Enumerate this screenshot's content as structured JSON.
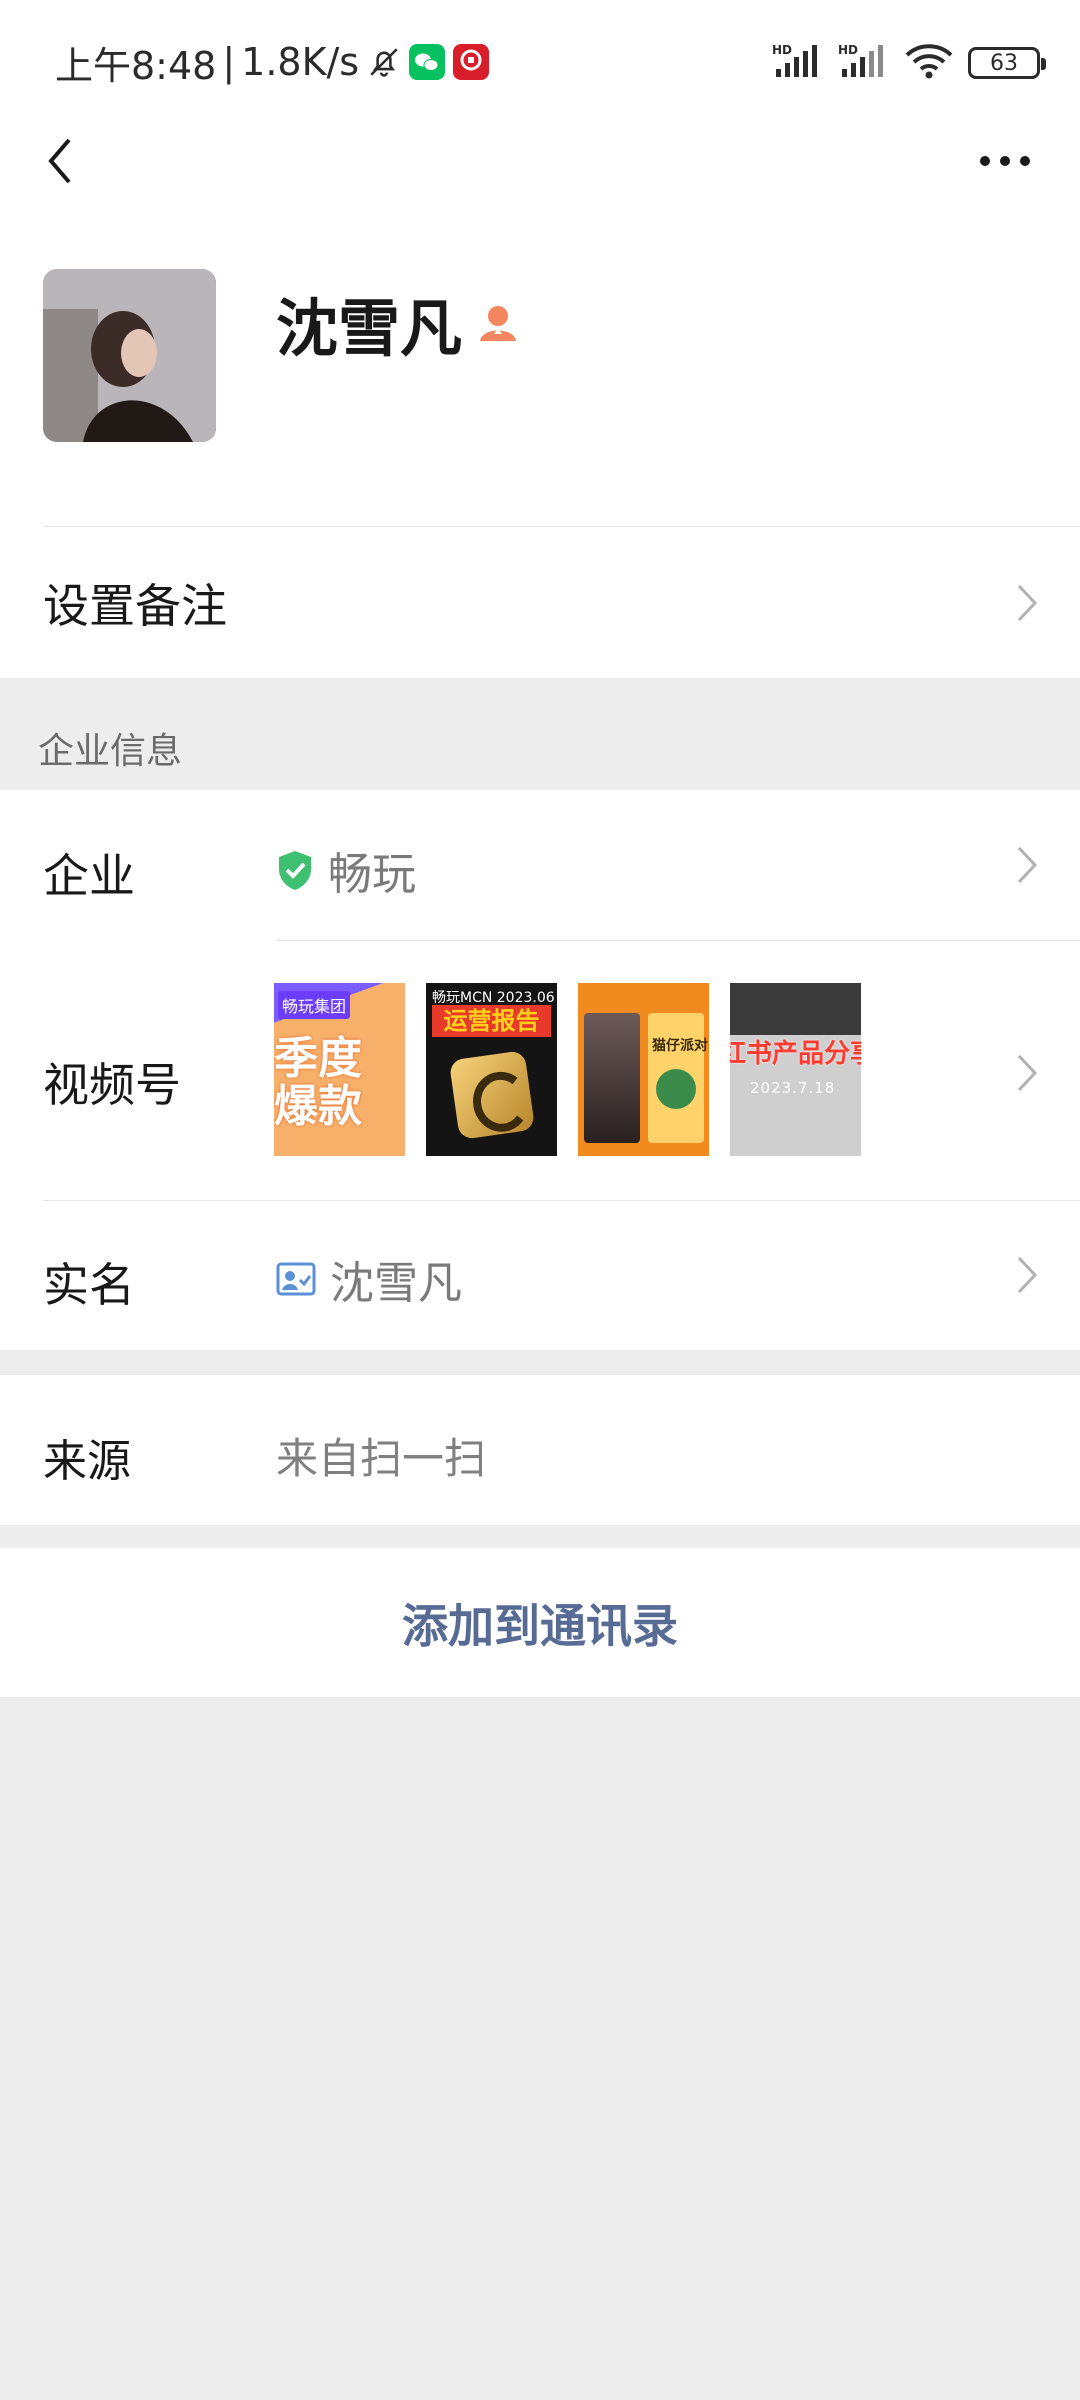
{
  "status_bar": {
    "time": "上午8:48",
    "separator": "|",
    "speed": "1.8K/s",
    "signal_1": "HD",
    "signal_2": "HD",
    "battery": "63"
  },
  "profile": {
    "name": "沈雪凡",
    "remark_label": "设置备注"
  },
  "section": {
    "title": "企业信息"
  },
  "company": {
    "enterprise_label": "企业",
    "enterprise_value": "畅玩",
    "channels_label": "视频号",
    "realname_label": "实名",
    "realname_value": "沈雪凡",
    "thumbnails": [
      {
        "tag": "畅玩集团",
        "big": "季度爆款"
      },
      {
        "head": "畅玩MCN 2023.06",
        "title": "运营报告"
      },
      {
        "label": "猫仔派对"
      },
      {
        "title": "红书产品分享",
        "date": "2023.7.18"
      }
    ]
  },
  "source": {
    "label": "来源",
    "value": "来自扫一扫"
  },
  "actions": {
    "add_to_contacts": "添加到通讯录"
  },
  "colors": {
    "link_blue": "#576b95",
    "verified_green": "#07c160",
    "gender_female": "#fa5151",
    "background": "#ededed"
  }
}
